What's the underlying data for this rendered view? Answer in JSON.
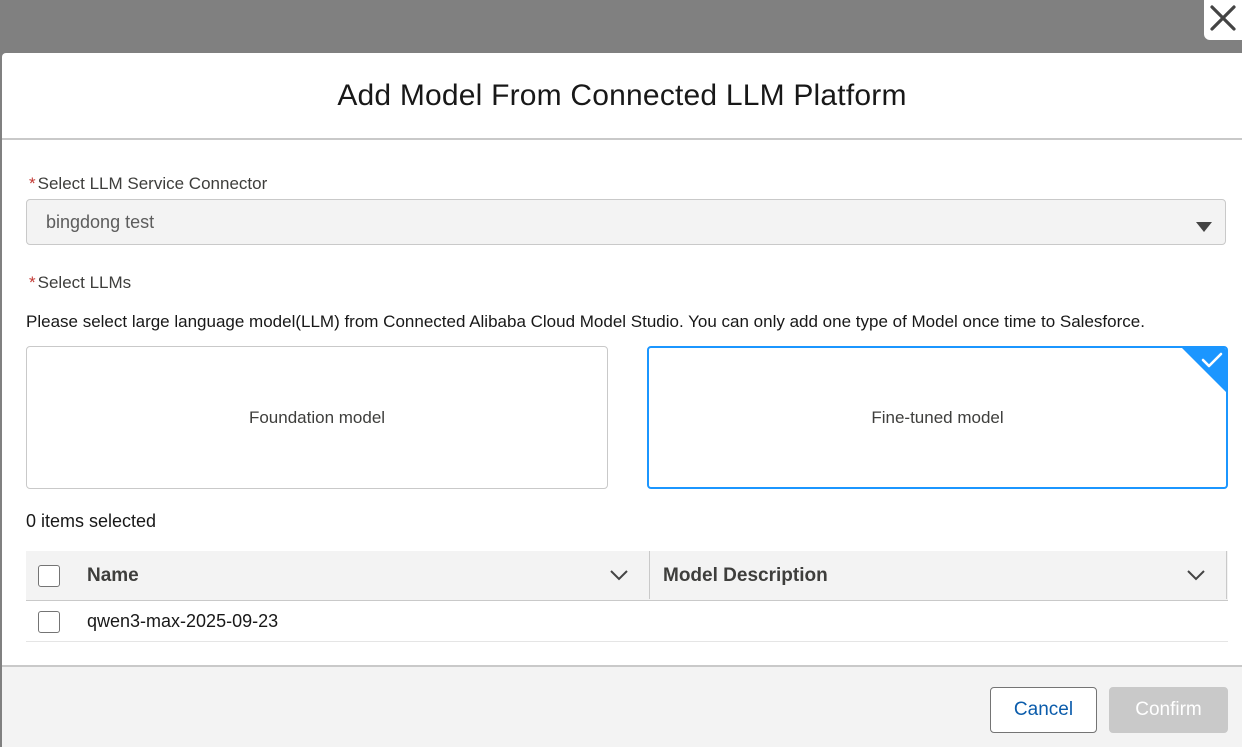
{
  "modal": {
    "title": "Add Model From Connected LLM Platform",
    "close_icon": "close-icon"
  },
  "connector_field": {
    "required_mark": "*",
    "label": "Select LLM Service Connector",
    "value": "bingdong test",
    "arrow_icon": "triangle-down-icon"
  },
  "llm_field": {
    "required_mark": "*",
    "label": "Select LLMs",
    "help_text": "Please select large language model(LLM) from Connected Alibaba Cloud Model Studio. You can only add one type of Model once time to Salesforce.",
    "options": [
      {
        "label": "Foundation model",
        "selected": false
      },
      {
        "label": "Fine-tuned model",
        "selected": true
      }
    ]
  },
  "table": {
    "selected_count_text": "0 items selected",
    "columns": [
      {
        "label": "Name"
      },
      {
        "label": "Model Description"
      }
    ],
    "rows": [
      {
        "name": "qwen3-max-2025-09-23",
        "description": ""
      }
    ]
  },
  "footer": {
    "cancel_label": "Cancel",
    "confirm_label": "Confirm",
    "confirm_disabled": true
  },
  "colors": {
    "brand_blue": "#1b96ff",
    "link_blue": "#0b5cab",
    "required_red": "#c23934",
    "overlay": "#808080"
  }
}
